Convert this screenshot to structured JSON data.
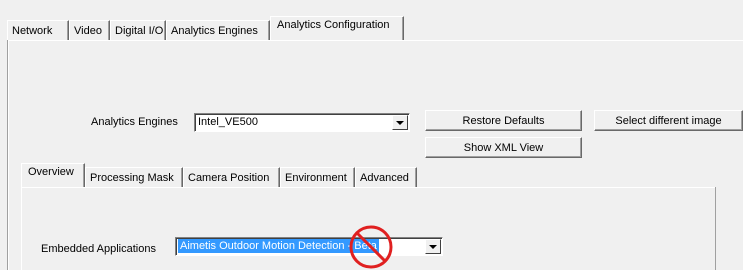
{
  "top_tabs": [
    "Network",
    "Video",
    "Digital I/O",
    "Analytics Engines",
    "Analytics Configuration"
  ],
  "engines": {
    "label": "Analytics Engines",
    "value": "Intel_VE500"
  },
  "buttons": {
    "restore": "Restore Defaults",
    "select_image": "Select different image",
    "xml_view": "Show XML View"
  },
  "sub_tabs": [
    "Overview",
    "Processing Mask",
    "Camera Position",
    "Environment",
    "Advanced"
  ],
  "embedded": {
    "label": "Embedded Applications",
    "value": "Aimetis Outdoor Motion Detection - Beta"
  },
  "colors": {
    "selection": "#3399ff",
    "prohibited": "#e02020"
  }
}
